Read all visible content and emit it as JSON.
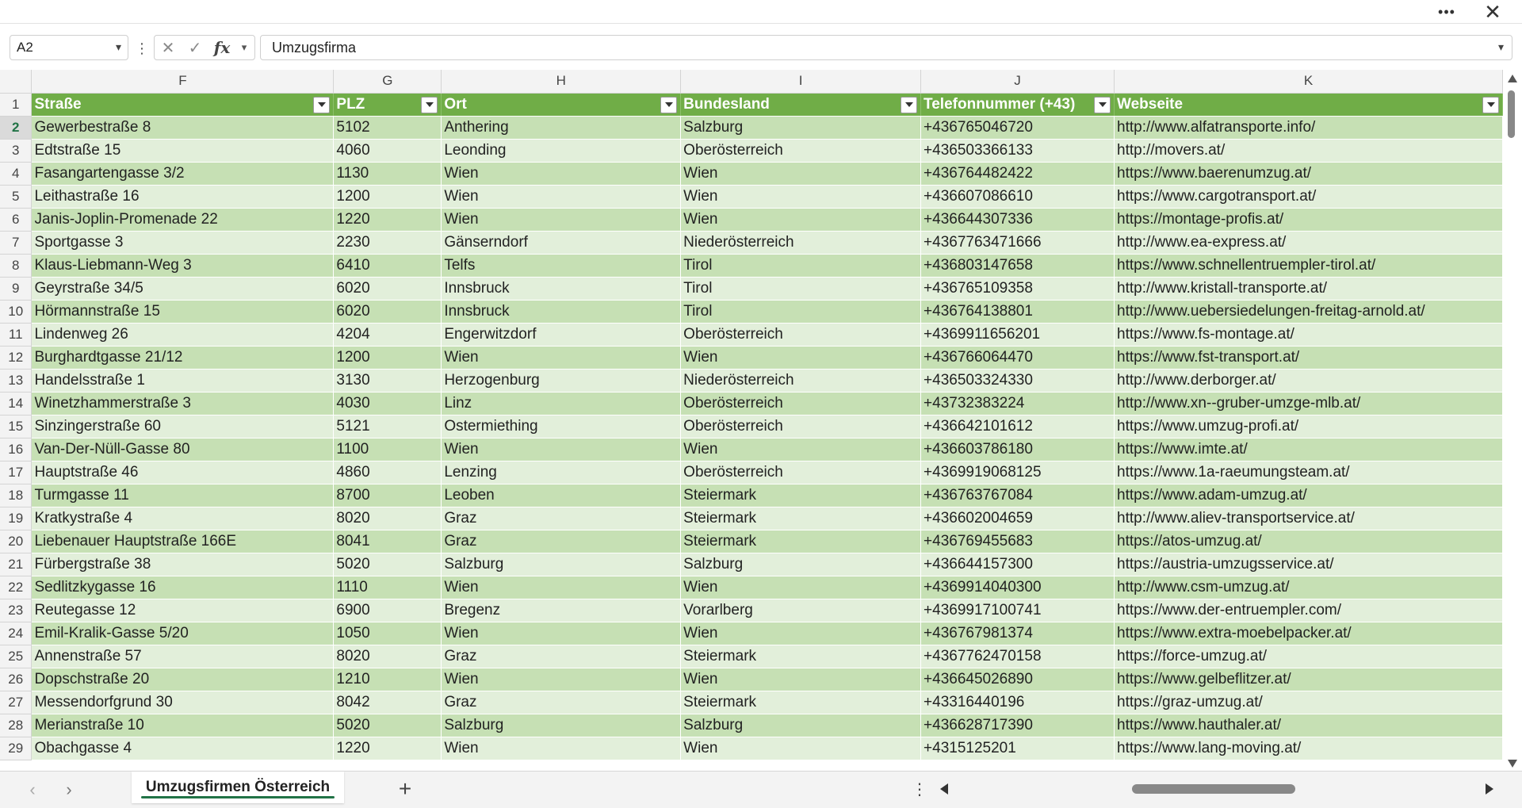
{
  "window": {
    "more_icon": "more-icon",
    "close_icon": "close-icon"
  },
  "formula_bar": {
    "cell_ref": "A2",
    "content": "Umzugsfirma"
  },
  "columns": [
    "F",
    "G",
    "H",
    "I",
    "J",
    "K"
  ],
  "headers": [
    "Straße",
    "PLZ",
    "Ort",
    "Bundesland",
    "Telefonnummer (+43)",
    "Webseite"
  ],
  "rows": [
    {
      "n": "2",
      "c": [
        "Gewerbestraße 8",
        "5102",
        "Anthering",
        "Salzburg",
        "+436765046720",
        "http://www.alfatransporte.info/"
      ]
    },
    {
      "n": "3",
      "c": [
        "Edtstraße 15",
        "4060",
        "Leonding",
        "Oberösterreich",
        "+436503366133",
        "http://movers.at/"
      ]
    },
    {
      "n": "4",
      "c": [
        "Fasangartengasse 3/2",
        "1130",
        "Wien",
        "Wien",
        "+436764482422",
        "https://www.baerenumzug.at/"
      ]
    },
    {
      "n": "5",
      "c": [
        "Leithastraße 16",
        "1200",
        "Wien",
        "Wien",
        "+436607086610",
        "https://www.cargotransport.at/"
      ]
    },
    {
      "n": "6",
      "c": [
        "Janis-Joplin-Promenade 22",
        "1220",
        "Wien",
        "Wien",
        "+436644307336",
        "https://montage-profis.at/"
      ]
    },
    {
      "n": "7",
      "c": [
        "Sportgasse 3",
        "2230",
        "Gänserndorf",
        "Niederösterreich",
        "+4367763471666",
        "http://www.ea-express.at/"
      ]
    },
    {
      "n": "8",
      "c": [
        "Klaus-Liebmann-Weg 3",
        "6410",
        "Telfs",
        "Tirol",
        "+436803147658",
        "https://www.schnellentruempler-tirol.at/"
      ]
    },
    {
      "n": "9",
      "c": [
        "Geyrstraße 34/5",
        "6020",
        "Innsbruck",
        "Tirol",
        "+436765109358",
        "http://www.kristall-transporte.at/"
      ]
    },
    {
      "n": "10",
      "c": [
        "Hörmannstraße 15",
        "6020",
        "Innsbruck",
        "Tirol",
        "+436764138801",
        "http://www.uebersiedelungen-freitag-arnold.at/"
      ]
    },
    {
      "n": "11",
      "c": [
        "Lindenweg 26",
        "4204",
        "Engerwitzdorf",
        "Oberösterreich",
        "+4369911656201",
        "https://www.fs-montage.at/"
      ]
    },
    {
      "n": "12",
      "c": [
        "Burghardtgasse 21/12",
        "1200",
        "Wien",
        "Wien",
        "+436766064470",
        "https://www.fst-transport.at/"
      ]
    },
    {
      "n": "13",
      "c": [
        "Handelsstraße 1",
        "3130",
        "Herzogenburg",
        "Niederösterreich",
        "+436503324330",
        "http://www.derborger.at/"
      ]
    },
    {
      "n": "14",
      "c": [
        "Winetzhammerstraße 3",
        "4030",
        "Linz",
        "Oberösterreich",
        "+43732383224",
        "http://www.xn--gruber-umzge-mlb.at/"
      ]
    },
    {
      "n": "15",
      "c": [
        "Sinzingerstraße 60",
        "5121",
        "Ostermiething",
        "Oberösterreich",
        "+436642101612",
        "https://www.umzug-profi.at/"
      ]
    },
    {
      "n": "16",
      "c": [
        "Van-Der-Nüll-Gasse 80",
        "1100",
        "Wien",
        "Wien",
        "+436603786180",
        "https://www.imte.at/"
      ]
    },
    {
      "n": "17",
      "c": [
        "Hauptstraße 46",
        "4860",
        "Lenzing",
        "Oberösterreich",
        "+4369919068125",
        "https://www.1a-raeumungsteam.at/"
      ]
    },
    {
      "n": "18",
      "c": [
        "Turmgasse 11",
        "8700",
        "Leoben",
        "Steiermark",
        "+436763767084",
        "https://www.adam-umzug.at/"
      ]
    },
    {
      "n": "19",
      "c": [
        "Kratkystraße 4",
        "8020",
        "Graz",
        "Steiermark",
        "+436602004659",
        "http://www.aliev-transportservice.at/"
      ]
    },
    {
      "n": "20",
      "c": [
        "Liebenauer Hauptstraße 166E",
        "8041",
        "Graz",
        "Steiermark",
        "+436769455683",
        "https://atos-umzug.at/"
      ]
    },
    {
      "n": "21",
      "c": [
        "Fürbergstraße 38",
        "5020",
        "Salzburg",
        "Salzburg",
        "+436644157300",
        "https://austria-umzugsservice.at/"
      ]
    },
    {
      "n": "22",
      "c": [
        "Sedlitzkygasse 16",
        "1110",
        "Wien",
        "Wien",
        "+4369914040300",
        "http://www.csm-umzug.at/"
      ]
    },
    {
      "n": "23",
      "c": [
        "Reutegasse 12",
        "6900",
        "Bregenz",
        "Vorarlberg",
        "+4369917100741",
        "https://www.der-entruempler.com/"
      ]
    },
    {
      "n": "24",
      "c": [
        "Emil-Kralik-Gasse 5/20",
        "1050",
        "Wien",
        "Wien",
        "+436767981374",
        "https://www.extra-moebelpacker.at/"
      ]
    },
    {
      "n": "25",
      "c": [
        "Annenstraße 57",
        "8020",
        "Graz",
        "Steiermark",
        "+4367762470158",
        "https://force-umzug.at/"
      ]
    },
    {
      "n": "26",
      "c": [
        "Dopschstraße 20",
        "1210",
        "Wien",
        "Wien",
        "+436645026890",
        "https://www.gelbeflitzer.at/"
      ]
    },
    {
      "n": "27",
      "c": [
        "Messendorfgrund 30",
        "8042",
        "Graz",
        "Steiermark",
        "+43316440196",
        "https://graz-umzug.at/"
      ]
    },
    {
      "n": "28",
      "c": [
        "Merianstraße 10",
        "5020",
        "Salzburg",
        "Salzburg",
        "+436628717390",
        "https://www.hauthaler.at/"
      ]
    },
    {
      "n": "29",
      "c": [
        "Obachgasse 4",
        "1220",
        "Wien",
        "Wien",
        "+4315125201",
        "https://www.lang-moving.at/"
      ]
    }
  ],
  "sheet_tabs": [
    "Umzugsfirmen Österreich"
  ],
  "colors": {
    "header_green": "#70ad47",
    "band_dark": "#c6e0b4",
    "band_light": "#e2efda",
    "accent": "#217346"
  }
}
